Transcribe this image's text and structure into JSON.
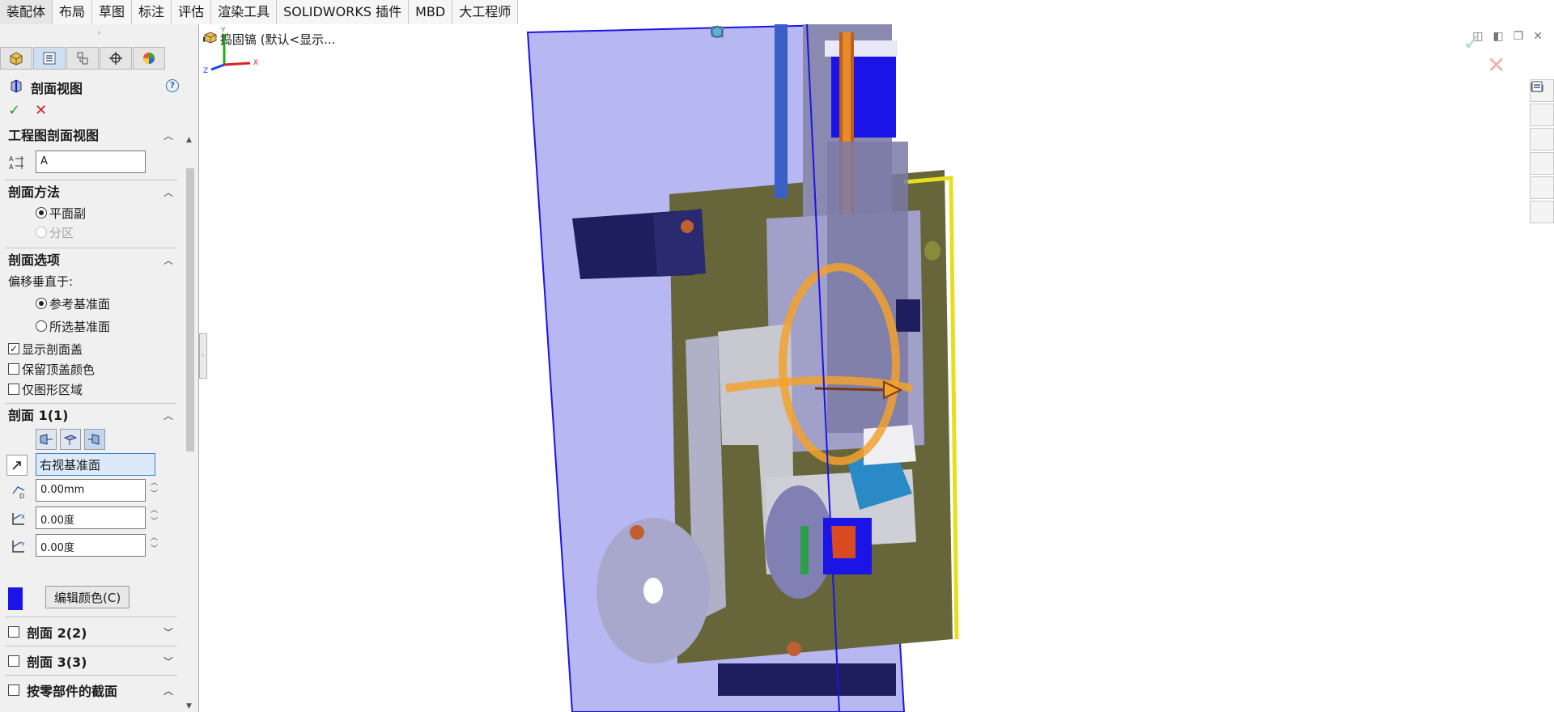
{
  "tabs": [
    "装配体",
    "布局",
    "草图",
    "标注",
    "评估",
    "渲染工具",
    "SOLIDWORKS 插件",
    "MBD",
    "大工程师"
  ],
  "panel": {
    "grip": "◦",
    "tab_icons": [
      "assembly-icon",
      "property-manager-icon",
      "config-manager-icon",
      "dimxpert-icon",
      "appearance-icon"
    ],
    "title": "剖面视图",
    "help": "?",
    "ok": "✓",
    "cancel": "✕",
    "drawing_section": {
      "header": "工程图剖面视图",
      "name_value": "A"
    },
    "method": {
      "header": "剖面方法",
      "options": [
        "平面副",
        "分区"
      ],
      "selected": 0
    },
    "options": {
      "header": "剖面选项",
      "offset_label": "偏移垂直于:",
      "radio": [
        "参考基准面",
        "所选基准面"
      ],
      "selected": 0,
      "checks": [
        {
          "label": "显示剖面盖",
          "checked": true
        },
        {
          "label": "保留顶盖颜色",
          "checked": false
        },
        {
          "label": "仅图形区域",
          "checked": false
        }
      ]
    },
    "section1": {
      "header": "剖面 1(1)",
      "plane": "右视基准面",
      "offset": "0.00mm",
      "angle_x": "0.00度",
      "angle_y": "0.00度",
      "edit_color": "编辑颜色(C)",
      "cap_color": "#1b14e6"
    },
    "section2": {
      "header": "剖面 2(2)"
    },
    "section3": {
      "header": "剖面 3(3)"
    },
    "by_part": {
      "header": "按零部件的截面"
    }
  },
  "viewport": {
    "tree_root": "捣固镐 (默认<显示...",
    "background": "#ffffff",
    "plane_color": "#b7b7f2",
    "triad": {
      "x": "X",
      "y": "Y",
      "z": "Z"
    }
  },
  "hud_icons": [
    "view-orientation-icon",
    "zoom-to-fit-icon",
    "zoom-area-icon",
    "previous-view-icon",
    "section-view-icon",
    "dynamic-annotation-icon",
    "display-style-icon",
    "hide-show-icon",
    "edit-appearance-icon",
    "scene-icon",
    "view-settings-icon",
    "3d-view-icon"
  ],
  "task_pane_icons": [
    "home-icon",
    "resources-icon",
    "design-library-icon",
    "file-explorer-icon",
    "view-palette-icon",
    "appearances-icon",
    "custom-properties-icon"
  ]
}
